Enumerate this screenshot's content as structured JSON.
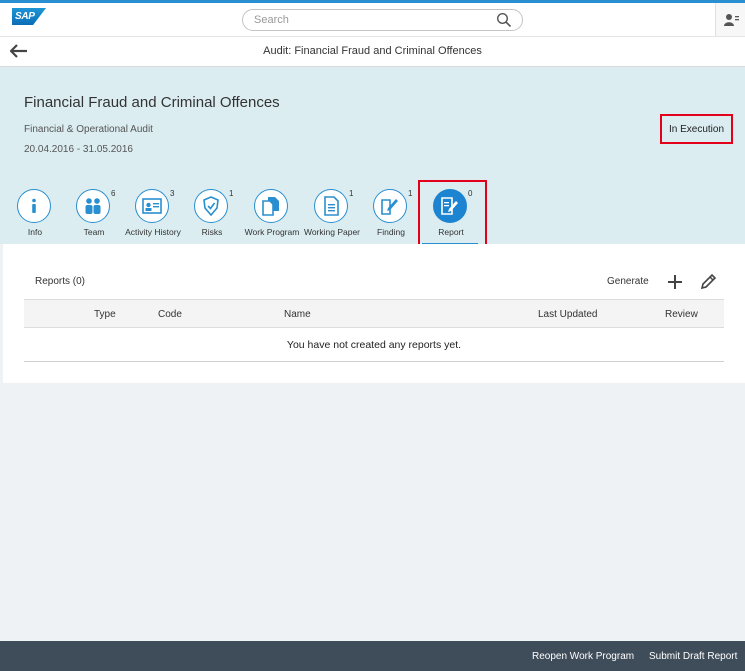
{
  "shell": {
    "logo": "SAP",
    "search_placeholder": "Search",
    "user_icon": "user-icon"
  },
  "subheader": {
    "title": "Audit: Financial Fraud and Criminal Offences",
    "back_icon": "arrow-left-icon"
  },
  "object": {
    "title": "Financial Fraud and Criminal Offences",
    "subtitle": "Financial & Operational Audit",
    "dates": "20.04.2016 - 31.05.2016",
    "status": "In Execution"
  },
  "tabs": [
    {
      "label": "Info",
      "icon": "info-icon",
      "count": ""
    },
    {
      "label": "Team",
      "icon": "group-icon",
      "count": "6"
    },
    {
      "label": "Activity History",
      "icon": "id-card-icon",
      "count": "3"
    },
    {
      "label": "Risks",
      "icon": "shield-icon",
      "count": "1"
    },
    {
      "label": "Work Program",
      "icon": "documents-icon",
      "count": ""
    },
    {
      "label": "Working Paper",
      "icon": "paper-icon",
      "count": "1"
    },
    {
      "label": "Finding",
      "icon": "edit-doc-icon",
      "count": "1"
    },
    {
      "label": "Report",
      "icon": "report-icon",
      "count": "0",
      "active": true
    }
  ],
  "reports": {
    "title": "Reports (0)",
    "generate_label": "Generate",
    "columns": [
      "Type",
      "Code",
      "Name",
      "Last Updated",
      "Review"
    ],
    "empty_text": "You have not created any reports yet."
  },
  "footer": {
    "reopen_label": "Reopen Work Program",
    "submit_label": "Submit Draft Report"
  },
  "colors": {
    "accent": "#2a8fd0",
    "highlight": "#e2001a",
    "footer_bg": "#3f4c5a",
    "header_bg": "#dbedf1"
  }
}
